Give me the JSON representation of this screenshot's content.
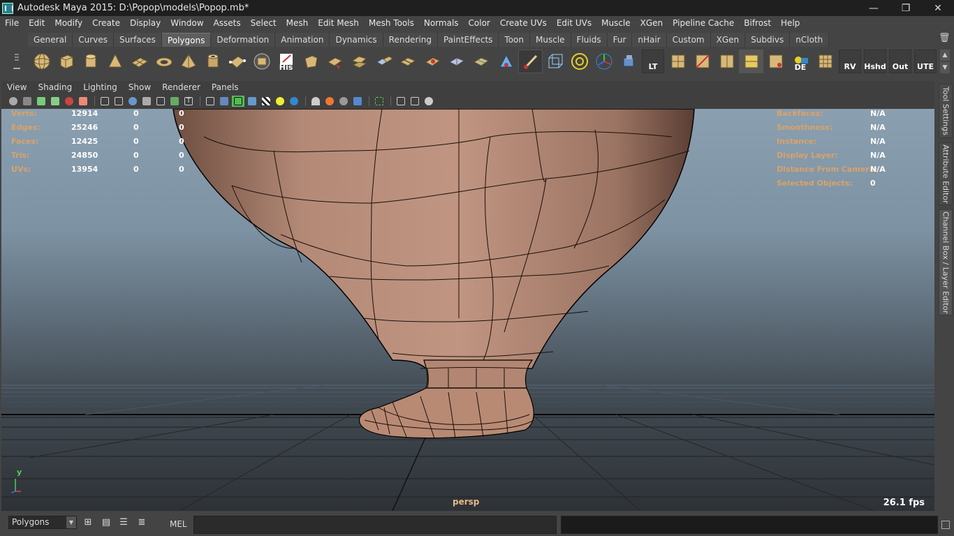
{
  "window": {
    "title": "Autodesk Maya 2015: D:\\Popop\\models\\Popop.mb*",
    "minimize": "—",
    "maximize": "❐",
    "close": "✕"
  },
  "menubar": [
    "File",
    "Edit",
    "Modify",
    "Create",
    "Display",
    "Window",
    "Assets",
    "Select",
    "Mesh",
    "Edit Mesh",
    "Mesh Tools",
    "Normals",
    "Color",
    "Create UVs",
    "Edit UVs",
    "Muscle",
    "XGen",
    "Pipeline Cache",
    "Bifrost",
    "Help"
  ],
  "shelf": {
    "tabs": [
      "General",
      "Curves",
      "Surfaces",
      "Polygons",
      "Deformation",
      "Animation",
      "Dynamics",
      "Rendering",
      "PaintEffects",
      "Toon",
      "Muscle",
      "Fluids",
      "Fur",
      "nHair",
      "Custom",
      "XGen",
      "Subdivs",
      "nCloth"
    ],
    "active_tab": "Polygons",
    "icon_labels": {
      "his": "His",
      "lt": "LT",
      "de": "DE",
      "rv": "RV",
      "hshd": "Hshd",
      "out": "Out",
      "ute": "UTE"
    }
  },
  "panel_menu": [
    "View",
    "Shading",
    "Lighting",
    "Show",
    "Renderer",
    "Panels"
  ],
  "hud_left": [
    {
      "label": "Verts:",
      "value": "12914",
      "sel": "0",
      "comp": "0"
    },
    {
      "label": "Edges:",
      "value": "25246",
      "sel": "0",
      "comp": "0"
    },
    {
      "label": "Faces:",
      "value": "12425",
      "sel": "0",
      "comp": "0"
    },
    {
      "label": "Tris:",
      "value": "24850",
      "sel": "0",
      "comp": "0"
    },
    {
      "label": "UVs:",
      "value": "13954",
      "sel": "0",
      "comp": "0"
    }
  ],
  "hud_right": [
    {
      "label": "Backfaces:",
      "value": "N/A"
    },
    {
      "label": "Smoothness:",
      "value": "N/A"
    },
    {
      "label": "Instance:",
      "value": "N/A"
    },
    {
      "label": "Display Layer:",
      "value": "N/A"
    },
    {
      "label": "Distance From Camera:",
      "value": "N/A"
    },
    {
      "label": "Selected Objects:",
      "value": "0"
    }
  ],
  "camera": "persp",
  "fps": "26.1 fps",
  "axis_label": "y",
  "side_tabs": [
    "Tool Settings",
    "Attribute Editor",
    "Channel Box / Layer Editor"
  ],
  "cmdline": {
    "mode": "Polygons",
    "mel_label": "MEL",
    "mel_value": ""
  },
  "colors": {
    "hud_label": "#d9a36a",
    "mesh_skin": "#b58a75",
    "accent_active_tab": "#5d5d5d"
  }
}
